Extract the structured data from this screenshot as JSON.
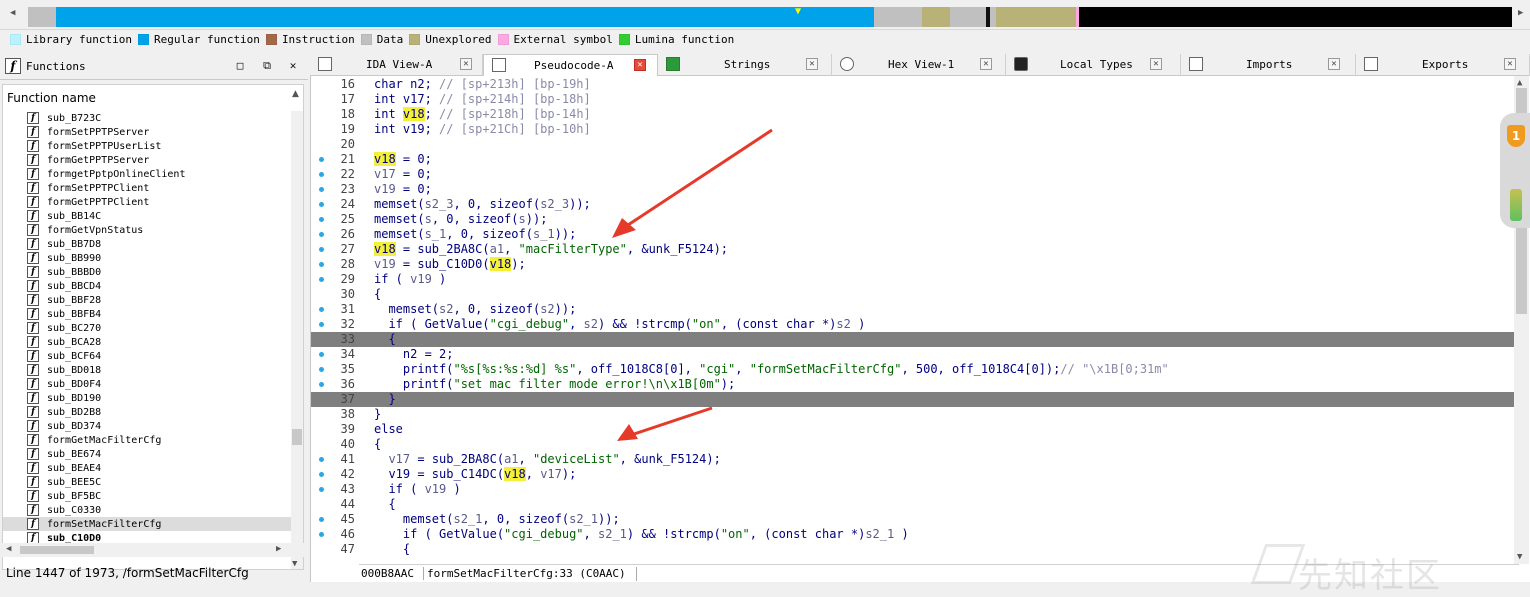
{
  "legend": [
    {
      "label": "Library function",
      "color": "#b8f4ff"
    },
    {
      "label": "Regular function",
      "color": "#00a3ea"
    },
    {
      "label": "Instruction",
      "color": "#a36848"
    },
    {
      "label": "Data",
      "color": "#c0c0c0"
    },
    {
      "label": "Unexplored",
      "color": "#b8b278"
    },
    {
      "label": "External symbol",
      "color": "#ffa7e2"
    },
    {
      "label": "Lumina function",
      "color": "#33cc33"
    }
  ],
  "functions_pane": {
    "title": "Functions",
    "column_header": "Function name",
    "status": "Line 1447 of 1973, /formSetMacFilterCfg",
    "items": [
      {
        "name": "sub_B723C"
      },
      {
        "name": "formSetPPTPServer"
      },
      {
        "name": "formSetPPTPUserList"
      },
      {
        "name": "formGetPPTPServer"
      },
      {
        "name": "formgetPptpOnlineClient"
      },
      {
        "name": "formSetPPTPClient"
      },
      {
        "name": "formGetPPTPClient"
      },
      {
        "name": "sub_BB14C"
      },
      {
        "name": "formGetVpnStatus"
      },
      {
        "name": "sub_BB7D8"
      },
      {
        "name": "sub_BB990"
      },
      {
        "name": "sub_BBBD0"
      },
      {
        "name": "sub_BBCD4"
      },
      {
        "name": "sub_BBF28"
      },
      {
        "name": "sub_BBFB4"
      },
      {
        "name": "sub_BC270"
      },
      {
        "name": "sub_BCA28"
      },
      {
        "name": "sub_BCF64"
      },
      {
        "name": "sub_BD018"
      },
      {
        "name": "sub_BD0F4"
      },
      {
        "name": "sub_BD190"
      },
      {
        "name": "sub_BD2B8"
      },
      {
        "name": "sub_BD374"
      },
      {
        "name": "formGetMacFilterCfg"
      },
      {
        "name": "sub_BE674"
      },
      {
        "name": "sub_BEAE4"
      },
      {
        "name": "sub_BEE5C"
      },
      {
        "name": "sub_BF5BC"
      },
      {
        "name": "sub_C0330"
      },
      {
        "name": "formSetMacFilterCfg",
        "selected": true
      },
      {
        "name": "sub_C10D0",
        "bold": true
      }
    ]
  },
  "tabs": [
    {
      "label": "IDA View-A",
      "active": false
    },
    {
      "label": "Pseudocode-A",
      "active": true
    },
    {
      "label": "Strings",
      "active": false
    },
    {
      "label": "Hex View-1",
      "active": false
    },
    {
      "label": "Local Types",
      "active": false
    },
    {
      "label": "Imports",
      "active": false
    },
    {
      "label": "Exports",
      "active": false
    }
  ],
  "code": {
    "lines": [
      {
        "num": "16",
        "dot": false,
        "hl": false,
        "parts": [
          [
            "",
            "char n2; "
          ],
          [
            "cm",
            "// [sp+213h] [bp-19h]"
          ]
        ]
      },
      {
        "num": "17",
        "dot": false,
        "hl": false,
        "parts": [
          [
            "",
            "int v17; "
          ],
          [
            "cm",
            "// [sp+214h] [bp-18h]"
          ]
        ]
      },
      {
        "num": "18",
        "dot": false,
        "hl": false,
        "parts": [
          [
            "",
            "int "
          ],
          [
            "yl",
            "v18"
          ],
          [
            "",
            "; "
          ],
          [
            "cm",
            "// [sp+218h] [bp-14h]"
          ]
        ]
      },
      {
        "num": "19",
        "dot": false,
        "hl": false,
        "parts": [
          [
            "",
            "int v19; "
          ],
          [
            "cm",
            "// [sp+21Ch] [bp-10h]"
          ]
        ]
      },
      {
        "num": "20",
        "dot": false,
        "hl": false,
        "parts": []
      },
      {
        "num": "21",
        "dot": true,
        "hl": false,
        "parts": [
          [
            "yl",
            "v18"
          ],
          [
            "",
            " = 0;"
          ]
        ]
      },
      {
        "num": "22",
        "dot": true,
        "hl": false,
        "parts": [
          [
            "vr",
            "v17"
          ],
          [
            "",
            " = 0;"
          ]
        ]
      },
      {
        "num": "23",
        "dot": true,
        "hl": false,
        "parts": [
          [
            "vr",
            "v19"
          ],
          [
            "",
            " = 0;"
          ]
        ]
      },
      {
        "num": "24",
        "dot": true,
        "hl": false,
        "parts": [
          [
            "",
            "memset("
          ],
          [
            "vr",
            "s2_3"
          ],
          [
            "",
            ", 0, sizeof("
          ],
          [
            "vr",
            "s2_3"
          ],
          [
            "",
            "));"
          ]
        ]
      },
      {
        "num": "25",
        "dot": true,
        "hl": false,
        "parts": [
          [
            "",
            "memset("
          ],
          [
            "vr",
            "s"
          ],
          [
            "",
            ", 0, sizeof("
          ],
          [
            "vr",
            "s"
          ],
          [
            "",
            "));"
          ]
        ]
      },
      {
        "num": "26",
        "dot": true,
        "hl": false,
        "parts": [
          [
            "",
            "memset("
          ],
          [
            "vr",
            "s_1"
          ],
          [
            "",
            ", 0, sizeof("
          ],
          [
            "vr",
            "s_1"
          ],
          [
            "",
            "));"
          ]
        ]
      },
      {
        "num": "27",
        "dot": true,
        "hl": false,
        "parts": [
          [
            "yl",
            "v18"
          ],
          [
            "",
            " = sub_2BA8C("
          ],
          [
            "vr",
            "a1"
          ],
          [
            "",
            ", "
          ],
          [
            "st",
            "\"macFilterType\""
          ],
          [
            "",
            ", &unk_F5124);"
          ]
        ]
      },
      {
        "num": "28",
        "dot": true,
        "hl": false,
        "parts": [
          [
            "vr",
            "v19"
          ],
          [
            "",
            " = sub_C10D0("
          ],
          [
            "yl",
            "v18"
          ],
          [
            "",
            ");"
          ]
        ]
      },
      {
        "num": "29",
        "dot": true,
        "hl": false,
        "parts": [
          [
            "",
            "if ( "
          ],
          [
            "vr",
            "v19"
          ],
          [
            "",
            " )"
          ]
        ]
      },
      {
        "num": "30",
        "dot": false,
        "hl": false,
        "parts": [
          [
            "",
            "{"
          ]
        ]
      },
      {
        "num": "31",
        "dot": true,
        "hl": false,
        "parts": [
          [
            "",
            "  memset("
          ],
          [
            "vr",
            "s2"
          ],
          [
            "",
            ", 0, sizeof("
          ],
          [
            "vr",
            "s2"
          ],
          [
            "",
            "));"
          ]
        ]
      },
      {
        "num": "32",
        "dot": true,
        "hl": false,
        "parts": [
          [
            "",
            "  if ( GetValue("
          ],
          [
            "st",
            "\"cgi_debug\""
          ],
          [
            "",
            ", "
          ],
          [
            "vr",
            "s2"
          ],
          [
            "",
            ") && !strcmp("
          ],
          [
            "st",
            "\"on\""
          ],
          [
            "",
            ", (const char *)"
          ],
          [
            "vr",
            "s2"
          ],
          [
            "",
            " )"
          ]
        ]
      },
      {
        "num": "33",
        "dot": false,
        "hl": true,
        "parts": [
          [
            "",
            "  {"
          ]
        ]
      },
      {
        "num": "34",
        "dot": true,
        "hl": false,
        "parts": [
          [
            "",
            "    n2 = 2;"
          ]
        ]
      },
      {
        "num": "35",
        "dot": true,
        "hl": false,
        "parts": [
          [
            "",
            "    printf("
          ],
          [
            "st",
            "\"%s[%s:%s:%d] %s\""
          ],
          [
            "",
            ", off_1018C8[0], "
          ],
          [
            "st",
            "\"cgi\""
          ],
          [
            "",
            ", "
          ],
          [
            "st",
            "\"formSetMacFilterCfg\""
          ],
          [
            "",
            ", 500, off_1018C4[0]);"
          ],
          [
            "cm",
            "// \"\\x1B[0;31m\""
          ]
        ]
      },
      {
        "num": "36",
        "dot": true,
        "hl": false,
        "parts": [
          [
            "",
            "    printf("
          ],
          [
            "st",
            "\"set mac filter mode error!\\n\\x1B[0m\""
          ],
          [
            "",
            ");"
          ]
        ]
      },
      {
        "num": "37",
        "dot": false,
        "hl": true,
        "parts": [
          [
            "",
            "  }"
          ]
        ]
      },
      {
        "num": "38",
        "dot": false,
        "hl": false,
        "parts": [
          [
            "",
            "}"
          ]
        ]
      },
      {
        "num": "39",
        "dot": false,
        "hl": false,
        "parts": [
          [
            "",
            "else"
          ]
        ]
      },
      {
        "num": "40",
        "dot": false,
        "hl": false,
        "parts": [
          [
            "",
            "{"
          ]
        ]
      },
      {
        "num": "41",
        "dot": true,
        "hl": false,
        "parts": [
          [
            "",
            "  "
          ],
          [
            "vr",
            "v17"
          ],
          [
            "",
            " = sub_2BA8C("
          ],
          [
            "vr",
            "a1"
          ],
          [
            "",
            ", "
          ],
          [
            "st",
            "\"deviceList\""
          ],
          [
            "",
            ", &unk_F5124);"
          ]
        ]
      },
      {
        "num": "42",
        "dot": true,
        "hl": false,
        "parts": [
          [
            "",
            "  v19 = sub_C14DC("
          ],
          [
            "yl",
            "v18"
          ],
          [
            "",
            ", "
          ],
          [
            "vr",
            "v17"
          ],
          [
            "",
            ");"
          ]
        ]
      },
      {
        "num": "43",
        "dot": true,
        "hl": false,
        "parts": [
          [
            "",
            "  if ( "
          ],
          [
            "vr",
            "v19"
          ],
          [
            "",
            " )"
          ]
        ]
      },
      {
        "num": "44",
        "dot": false,
        "hl": false,
        "parts": [
          [
            "",
            "  {"
          ]
        ]
      },
      {
        "num": "45",
        "dot": true,
        "hl": false,
        "parts": [
          [
            "",
            "    memset("
          ],
          [
            "vr",
            "s2_1"
          ],
          [
            "",
            ", 0, sizeof("
          ],
          [
            "vr",
            "s2_1"
          ],
          [
            "",
            "));"
          ]
        ]
      },
      {
        "num": "46",
        "dot": true,
        "hl": false,
        "parts": [
          [
            "",
            "    if ( GetValue("
          ],
          [
            "st",
            "\"cgi_debug\""
          ],
          [
            "",
            ", "
          ],
          [
            "vr",
            "s2_1"
          ],
          [
            "",
            ") && !strcmp("
          ],
          [
            "st",
            "\"on\""
          ],
          [
            "",
            ", (const char *)"
          ],
          [
            "vr",
            "s2_1"
          ],
          [
            "",
            " )"
          ]
        ]
      },
      {
        "num": "47",
        "dot": false,
        "hl": false,
        "parts": [
          [
            "",
            "    {"
          ]
        ]
      }
    ]
  },
  "code_status": {
    "address": "000B8AAC",
    "location": "formSetMacFilterCfg:33 (C0AAC)"
  },
  "side_widget": {
    "badge": "1"
  },
  "watermark": "先知社区"
}
